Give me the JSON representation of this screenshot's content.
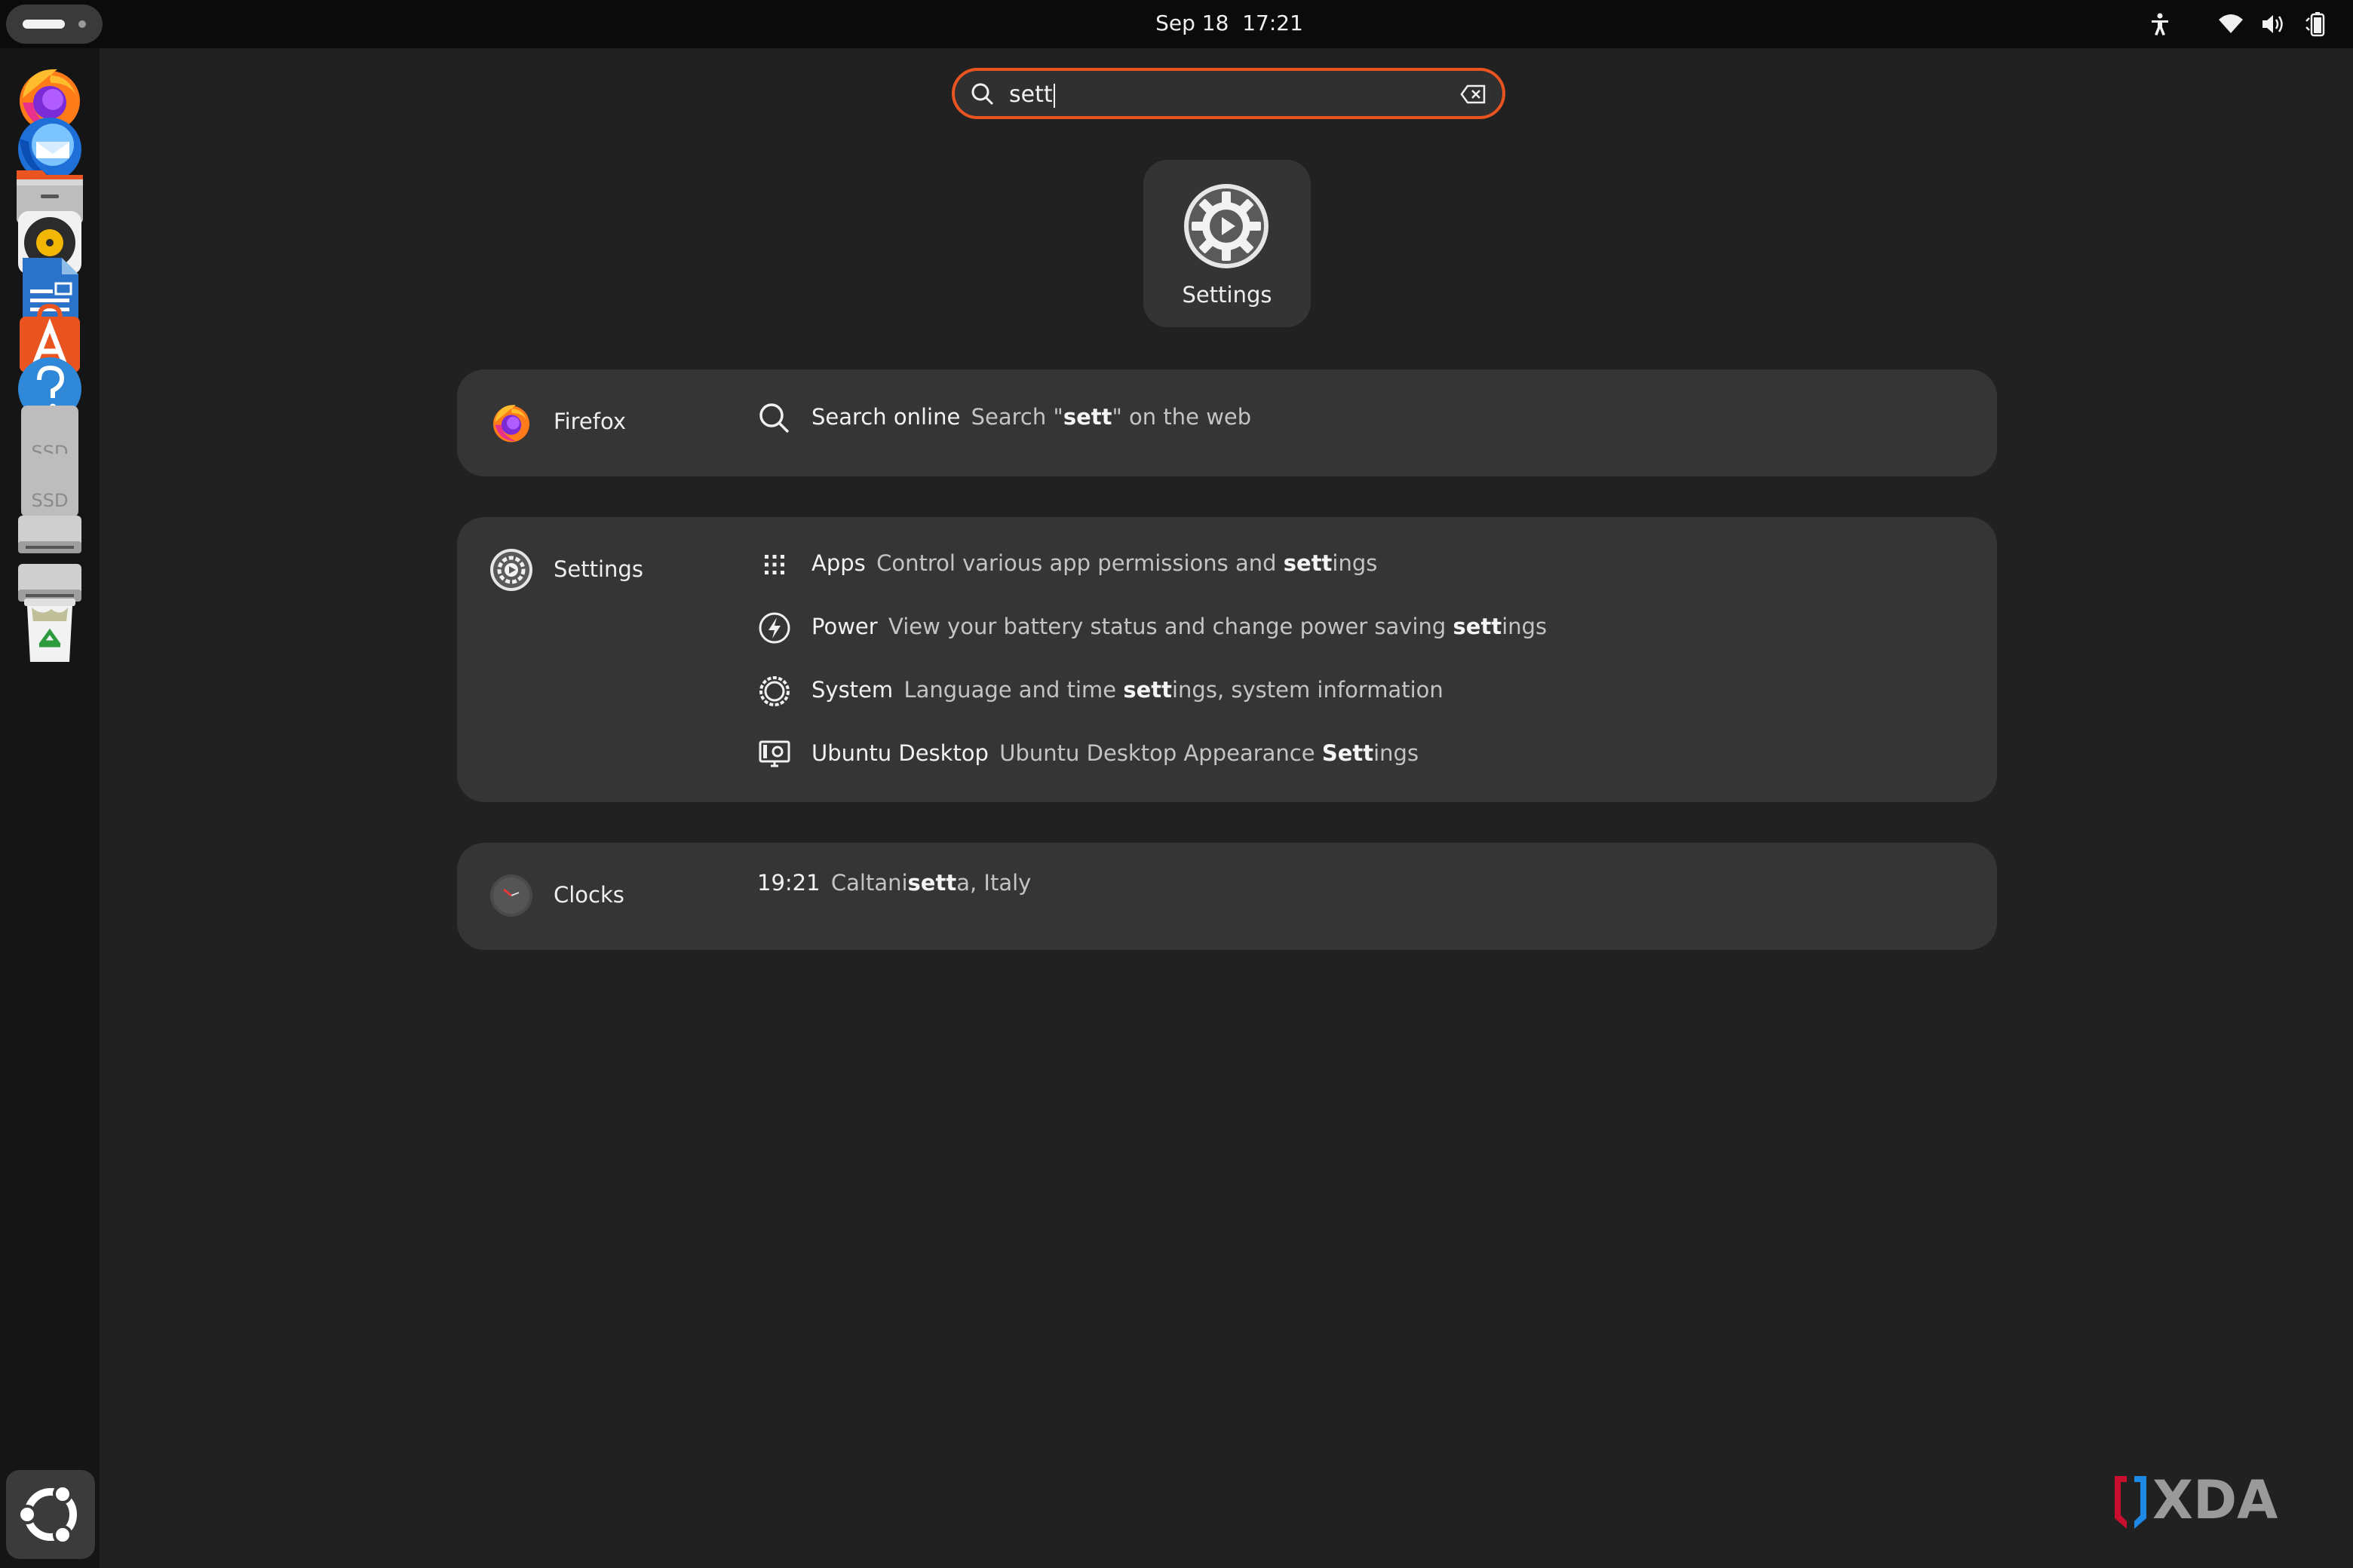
{
  "topbar": {
    "datetime": "Sep 18  17:21"
  },
  "dock": {
    "items": [
      {
        "name": "firefox-icon"
      },
      {
        "name": "thunderbird-icon"
      },
      {
        "name": "files-icon"
      },
      {
        "name": "rhythmbox-icon"
      },
      {
        "name": "libreoffice-writer-icon"
      },
      {
        "name": "app-center-icon"
      },
      {
        "name": "help-icon"
      },
      {
        "name": "ssd-drive-icon",
        "label": "SSD"
      },
      {
        "name": "ssd-drive-icon",
        "label": "SSD"
      },
      {
        "name": "disk-drive-icon"
      },
      {
        "name": "disk-drive-icon"
      },
      {
        "name": "trash-icon"
      }
    ],
    "show_apps": "ubuntu-logo-icon"
  },
  "search": {
    "value": "sett"
  },
  "app_result": {
    "label": "Settings",
    "icon": "settings-gear-icon"
  },
  "providers": {
    "firefox": {
      "name": "Firefox",
      "row": {
        "title": "Search online",
        "desc_pre": "Search \"",
        "desc_bold": "sett",
        "desc_post": "\" on the web"
      }
    },
    "settings": {
      "name": "Settings",
      "rows": [
        {
          "title": "Apps",
          "desc_pre": "Control various app permissions and ",
          "desc_bold": "sett",
          "desc_post": "ings"
        },
        {
          "title": "Power",
          "desc_pre": "View your battery status and change power saving ",
          "desc_bold": "sett",
          "desc_post": "ings"
        },
        {
          "title": "System",
          "desc_pre": "Language and time ",
          "desc_bold": "sett",
          "desc_post": "ings, system information"
        },
        {
          "title": "Ubuntu Desktop",
          "desc_pre": "Ubuntu Desktop Appearance ",
          "desc_bold": "Sett",
          "desc_post": "ings"
        }
      ]
    },
    "clocks": {
      "name": "Clocks",
      "row": {
        "title": "19:21",
        "desc_pre": "Caltani",
        "desc_bold": "sett",
        "desc_post": "a, Italy"
      }
    }
  },
  "watermark": "XDA",
  "colors": {
    "accent": "#e95420",
    "panel": "#353535",
    "background": "#212121"
  }
}
